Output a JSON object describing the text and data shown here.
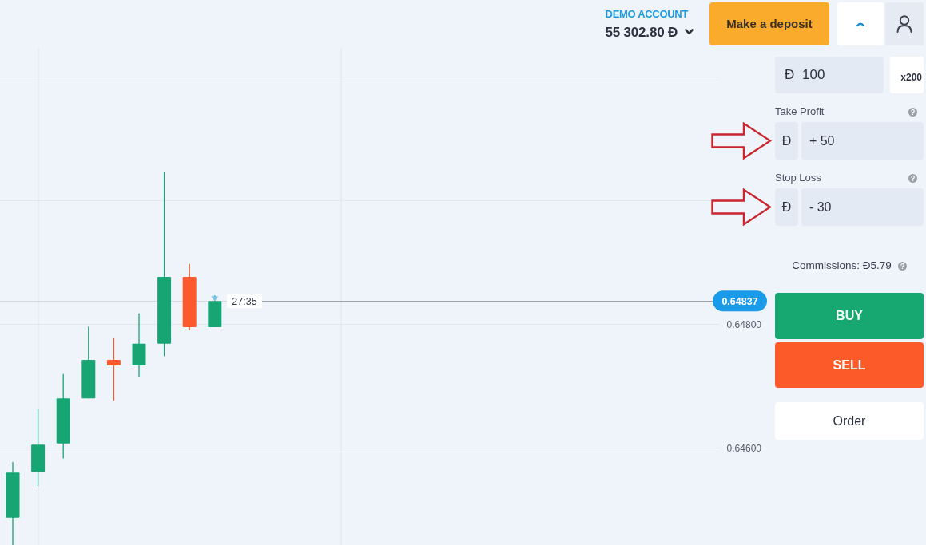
{
  "account": {
    "label": "DEMO ACCOUNT",
    "balance": "55 302.80 Đ"
  },
  "deposit_button": {
    "label": "Make a deposit"
  },
  "chart": {
    "axis_labels": [
      "0.64800",
      "0.64600"
    ],
    "price_label": "0.64837",
    "countdown": "27:35"
  },
  "trade_panel": {
    "amount": {
      "value": "Đ 100"
    },
    "multiplier": "x200",
    "limits": [
      {
        "label": "Take Profit",
        "currency": "Đ",
        "value": "+ 50"
      },
      {
        "label": "Stop Loss",
        "currency": "Đ",
        "value": "- 30"
      }
    ],
    "commissions": "Commissions: Đ5.79",
    "buttons": [
      {
        "label": "BUY",
        "kind": "buy"
      },
      {
        "label": "SELL",
        "kind": "sell"
      }
    ],
    "order_button": "Order"
  }
}
